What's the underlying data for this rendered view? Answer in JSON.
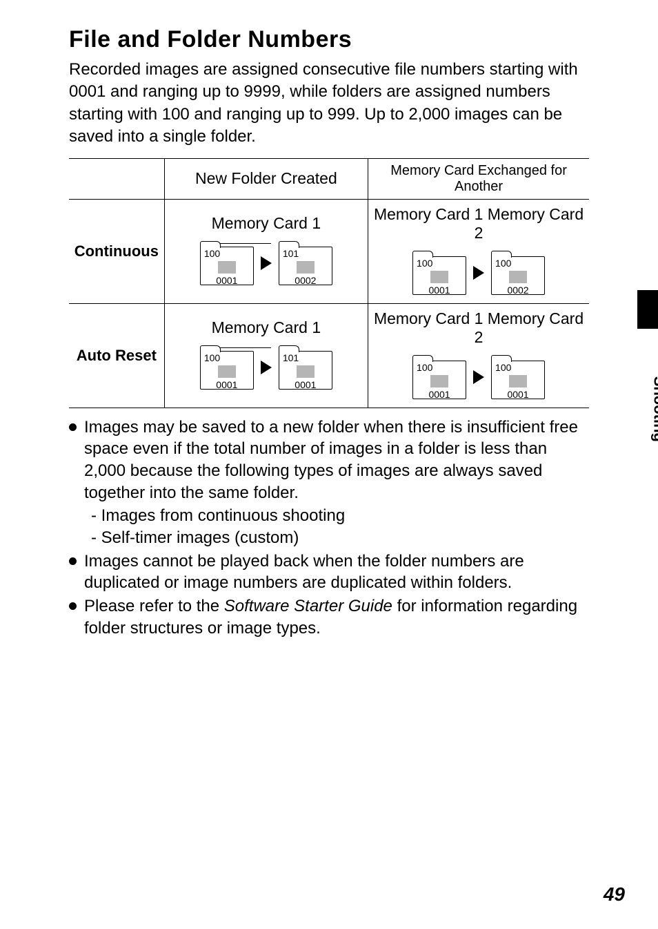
{
  "heading": "File and Folder Numbers",
  "intro": "Recorded images are assigned consecutive file numbers starting with 0001 and ranging up to 9999, while folders are assigned numbers starting with 100 and ranging up to 999. Up to 2,000 images can be saved into a single folder.",
  "table": {
    "headers": {
      "col1": "",
      "col2": "New Folder Created",
      "col3": "Memory Card Exchanged for Another"
    },
    "rows": [
      {
        "label": "Continuous",
        "cells": [
          {
            "title": "Memory Card 1",
            "folders": [
              {
                "folder_num": "100",
                "image_num": "0001"
              },
              {
                "folder_num": "101",
                "image_num": "0002"
              }
            ]
          },
          {
            "title": "Memory Card 1 Memory Card 2",
            "folders": [
              {
                "folder_num": "100",
                "image_num": "0001"
              },
              {
                "folder_num": "100",
                "image_num": "0002"
              }
            ]
          }
        ]
      },
      {
        "label": "Auto Reset",
        "cells": [
          {
            "title": "Memory Card 1",
            "folders": [
              {
                "folder_num": "100",
                "image_num": "0001"
              },
              {
                "folder_num": "101",
                "image_num": "0001"
              }
            ]
          },
          {
            "title": "Memory Card 1 Memory Card 2",
            "folders": [
              {
                "folder_num": "100",
                "image_num": "0001"
              },
              {
                "folder_num": "100",
                "image_num": "0001"
              }
            ]
          }
        ]
      }
    ]
  },
  "bullets": [
    {
      "text": "Images may be saved to a new folder when there is insufficient free space even if the total number of images in a folder is less than 2,000 because the following types of images are always saved together into the same folder.",
      "subitems": [
        "- Images from continuous shooting",
        "- Self-timer images (custom)"
      ]
    },
    {
      "text": "Images cannot be played back when the folder numbers are duplicated or image numbers are duplicated within folders."
    },
    {
      "text_pre": "Please refer to the ",
      "text_italic": "Software Starter Guide",
      "text_post": " for information regarding folder structures or image types."
    }
  ],
  "side_label": "Shooting",
  "page_number": "49"
}
